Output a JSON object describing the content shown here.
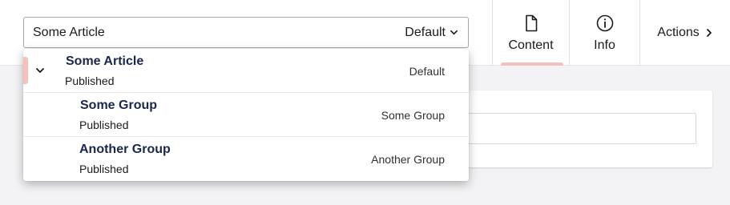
{
  "variant_selector": {
    "name": "Some Article",
    "current_segment": "Default"
  },
  "app_nav": {
    "content_label": "Content",
    "info_label": "Info",
    "actions_label": "Actions"
  },
  "dropdown": {
    "variants": [
      {
        "title": "Some Article",
        "state": "Published",
        "segment": "Default",
        "selected": true
      },
      {
        "title": "Some Group",
        "state": "Published",
        "segment": "Some Group",
        "selected": false
      },
      {
        "title": "Another Group",
        "state": "Published",
        "segment": "Another Group",
        "selected": false
      }
    ]
  },
  "colors": {
    "accent": "#f5c1bc",
    "title_text": "#1b264f",
    "border": "#a9a9ad"
  }
}
